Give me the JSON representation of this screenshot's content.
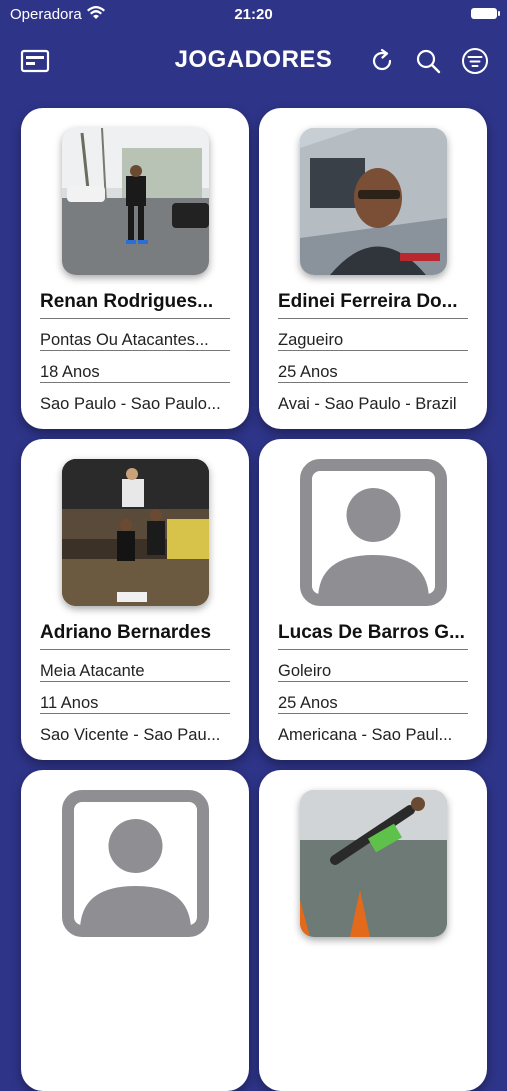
{
  "status_bar": {
    "carrier": "Operadora",
    "time": "21:20"
  },
  "nav": {
    "title": "JOGADORES",
    "left_icon": "card-icon",
    "right_icons": [
      "refresh-icon",
      "search-icon",
      "filter-icon"
    ]
  },
  "colors": {
    "background": "#2e3488",
    "card": "#ffffff",
    "placeholder": "#8e8e93"
  },
  "players": [
    {
      "name": "Renan Rodrigues...",
      "position": "Pontas Ou Atacantes...",
      "age": "18 Anos",
      "location": "Sao Paulo - Sao Paulo...",
      "photo": "street-photo"
    },
    {
      "name": "Edinei Ferreira Do...",
      "position": "Zagueiro",
      "age": "25 Anos",
      "location": "Avai - Sao Paulo - Brazil",
      "photo": "car-selfie-photo"
    },
    {
      "name": "Adriano Bernardes",
      "position": "Meia Atacante",
      "age": "11 Anos",
      "location": "Sao Vicente - Sao Pau...",
      "photo": "futsal-photo"
    },
    {
      "name": "Lucas De Barros G...",
      "position": "Goleiro",
      "age": "25 Anos",
      "location": "Americana - Sao Paul...",
      "photo": "placeholder-icon"
    },
    {
      "name": "",
      "position": "",
      "age": "",
      "location": "",
      "photo": "placeholder-icon"
    },
    {
      "name": "",
      "position": "",
      "age": "",
      "location": "",
      "photo": "goalkeeper-photo"
    }
  ]
}
